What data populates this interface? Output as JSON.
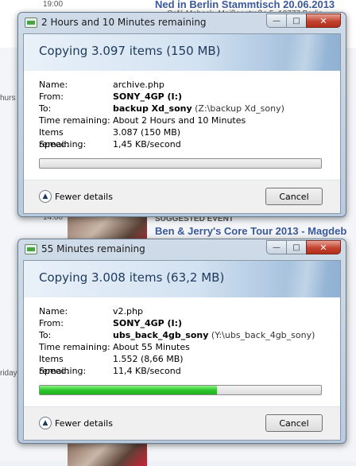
{
  "background": {
    "texts": [
      {
        "text": "Ned in Berlin Stammtisch 20.06.2013",
        "kind": "link"
      },
      {
        "text": "Café Mabock, Meißenstraße 5, 10777 Berlin",
        "kind": "small"
      },
      {
        "text": "hurs",
        "kind": "small"
      },
      {
        "text": "SUGGESTED EVENT",
        "kind": "small"
      },
      {
        "text": "Ben & Jerry's Core Tour 2013 - Magdeb",
        "kind": "link"
      },
      {
        "text": "riday",
        "kind": "small"
      },
      {
        "text": "19:00",
        "kind": "small"
      },
      {
        "text": "14:00",
        "kind": "small"
      }
    ]
  },
  "windows": [
    {
      "title": "2 Hours and 10 Minutes remaining",
      "heading": "Copying 3.097 items (150 MB)",
      "labels": {
        "name": "Name:",
        "from": "From:",
        "to": "To:",
        "time": "Time remaining:",
        "items": "Items remaining:",
        "speed": "Speed:"
      },
      "name": "archive.php",
      "from": "SONY_4GP (I:)",
      "to_main": "backup Xd_sony",
      "to_path": "(Z:\\backup Xd_sony)",
      "time_remaining": "About 2 Hours and 10 Minutes",
      "items_remaining": "3.087 (150 MB)",
      "speed": "1,45 KB/second",
      "progress": 0.0,
      "fewer_details": "Fewer details",
      "cancel": "Cancel"
    },
    {
      "title": "55 Minutes remaining",
      "heading": "Copying 3.008 items (63,2 MB)",
      "labels": {
        "name": "Name:",
        "from": "From:",
        "to": "To:",
        "time": "Time remaining:",
        "items": "Items remaining:",
        "speed": "Speed:"
      },
      "name": "v2.php",
      "from": "SONY_4GP (I:)",
      "to_main": "ubs_back_4gb_sony",
      "to_path": "(Y:\\ubs_back_4gb_sony)",
      "time_remaining": "About 55 Minutes",
      "items_remaining": "1.552 (8,66 MB)",
      "speed": "11,4 KB/second",
      "progress": 0.63,
      "fewer_details": "Fewer details",
      "cancel": "Cancel"
    }
  ],
  "colors": {
    "progress_fill": "#2fc82c",
    "heading": "#1e395b",
    "link": "#3b5998"
  }
}
